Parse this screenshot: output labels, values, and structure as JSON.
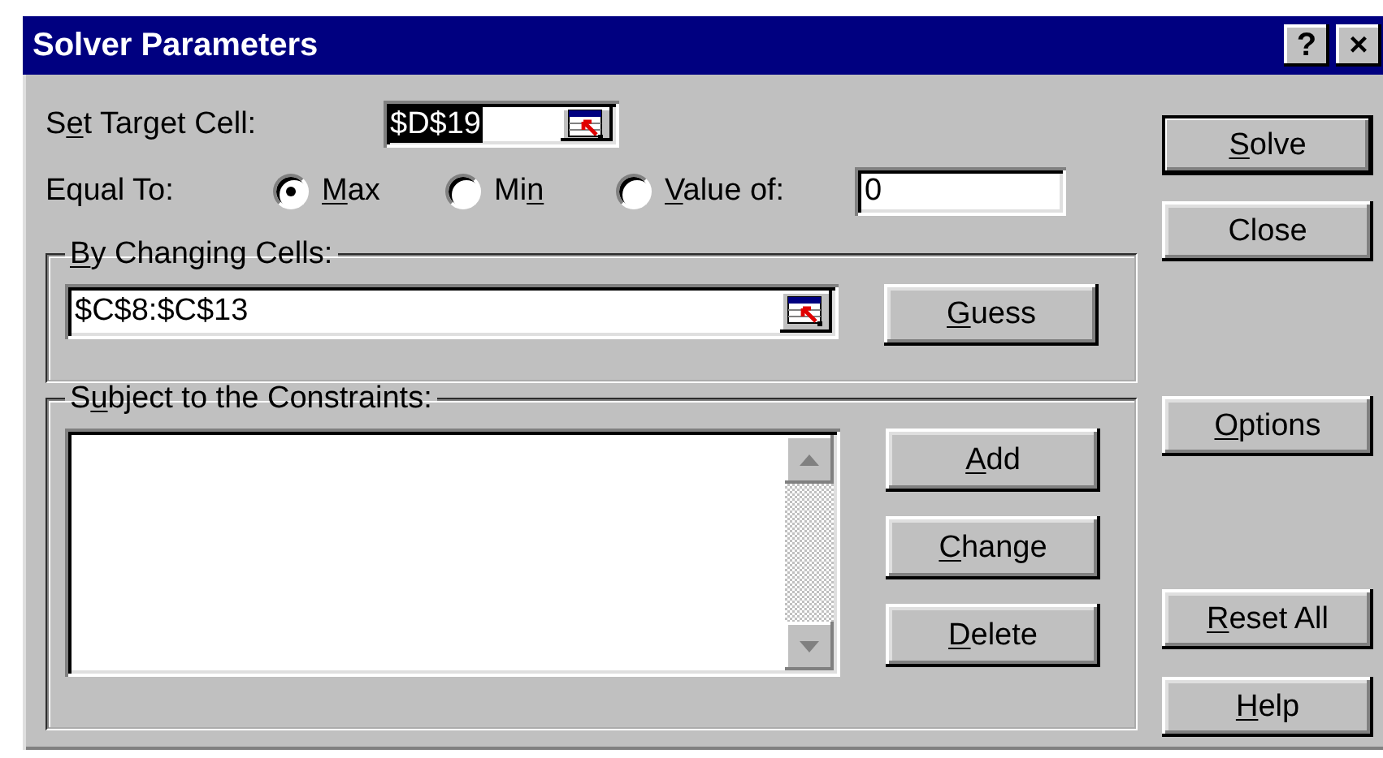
{
  "window": {
    "title": "Solver Parameters"
  },
  "title_buttons": [
    {
      "kind": "help",
      "label": "?"
    },
    {
      "kind": "close",
      "label": "×"
    }
  ],
  "target_cell": {
    "label": {
      "pre": "S",
      "key": "e",
      "post": "t Target Cell:"
    },
    "value": "$D$19",
    "selected": true
  },
  "equal_to": {
    "label": {
      "pre": "Equal To:"
    },
    "value": "0",
    "options": [
      {
        "label": {
          "key": "M",
          "post": "ax"
        },
        "selected": true
      },
      {
        "label": {
          "pre": "Mi",
          "key": "n"
        },
        "selected": false
      },
      {
        "label": {
          "key": "V",
          "post": "alue of:"
        },
        "selected": false
      }
    ]
  },
  "changing_cells": {
    "label": {
      "key": "B",
      "post": "y Changing Cells:"
    },
    "value": "$C$8:$C$13",
    "button": {
      "key": "G",
      "post": "uess"
    }
  },
  "constraints": {
    "label": {
      "pre": "S",
      "key": "u",
      "post": "bject to the Constraints:"
    },
    "buttons": [
      {
        "key": "A",
        "post": "dd"
      },
      {
        "key": "C",
        "post": "hange"
      },
      {
        "key": "D",
        "post": "elete"
      }
    ]
  },
  "buttons": [
    {
      "label": {
        "key": "S",
        "post": "olve"
      },
      "default": true
    },
    {
      "label": {
        "pre": "Close"
      },
      "default": false
    },
    {
      "label": {
        "key": "O",
        "post": "ptions"
      },
      "default": false
    },
    {
      "label": {
        "key": "R",
        "post": "eset All"
      },
      "default": false
    },
    {
      "label": {
        "key": "H",
        "post": "elp"
      },
      "default": false
    }
  ]
}
